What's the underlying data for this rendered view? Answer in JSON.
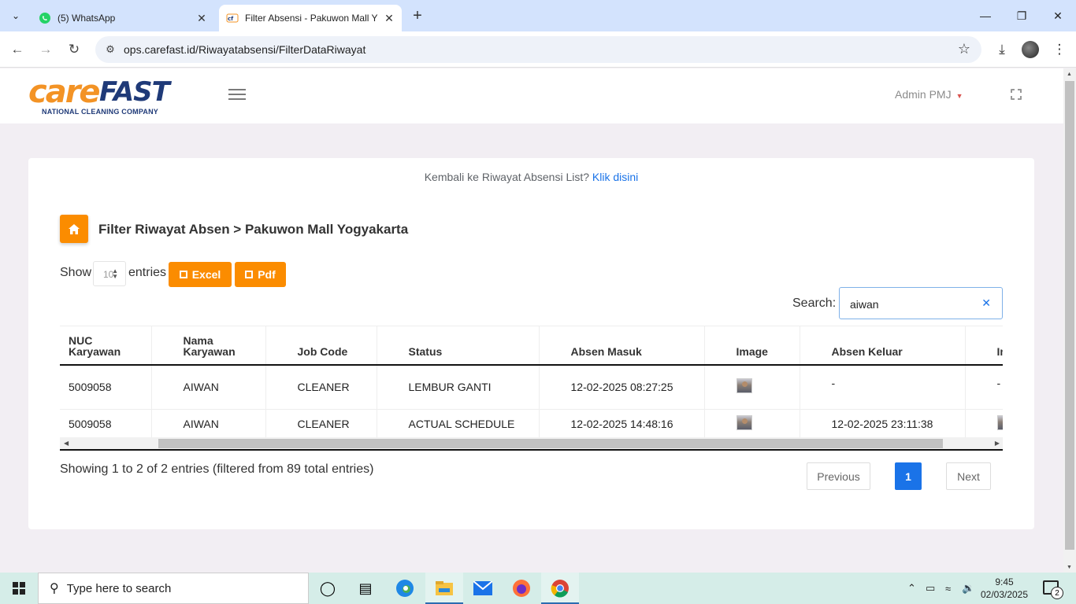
{
  "browser": {
    "tabs": [
      {
        "title": "(5) WhatsApp",
        "icon": "whatsapp-icon",
        "active": false
      },
      {
        "title": "Filter Absensi - Pakuwon Mall Y",
        "icon": "carefast-favicon-icon",
        "active": true
      }
    ],
    "url": "ops.carefast.id/Riwayatabsensi/FilterDataRiwayat"
  },
  "header": {
    "logo_main": "care",
    "logo_brand": "FAST",
    "logo_tagline": "NATIONAL CLEANING COMPANY",
    "user_name": "Admin PMJ"
  },
  "page": {
    "back_text": "Kembali ke Riwayat Absensi List?",
    "back_link": "Klik disini",
    "title": "Filter Riwayat Absen > Pakuwon Mall Yogyakarta",
    "show_label": "Show",
    "entries_value": "10",
    "entries_label": "entries",
    "excel_label": "Excel",
    "pdf_label": "Pdf",
    "search_label": "Search:",
    "search_value": "aiwan",
    "info_text": "Showing 1 to 2 of 2 entries (filtered from 89 total entries)",
    "pagination": {
      "previous": "Previous",
      "current": "1",
      "next": "Next"
    }
  },
  "table": {
    "headers": {
      "nuc": "NUC Karyawan",
      "nama": "Nama Karyawan",
      "job": "Job Code",
      "status": "Status",
      "masuk": "Absen Masuk",
      "image": "Image",
      "keluar": "Absen Keluar",
      "image2": "Im"
    },
    "rows": [
      {
        "nuc": "5009058",
        "nama": "AIWAN",
        "job": "CLEANER",
        "status": "LEMBUR GANTI",
        "masuk": "12-02-2025 08:27:25",
        "keluar": "-",
        "image2": "-"
      },
      {
        "nuc": "5009058",
        "nama": "AIWAN",
        "job": "CLEANER",
        "status": "ACTUAL SCHEDULE",
        "masuk": "12-02-2025 14:48:16",
        "keluar": "12-02-2025 23:11:38",
        "image2": ""
      }
    ]
  },
  "taskbar": {
    "search_placeholder": "Type here to search",
    "time": "9:45",
    "date": "02/03/2025",
    "notifications": "2"
  },
  "colors": {
    "accent": "#fb8c00",
    "link": "#1a73e8",
    "brand_blue": "#1f3a78",
    "brand_orange": "#f39325"
  }
}
